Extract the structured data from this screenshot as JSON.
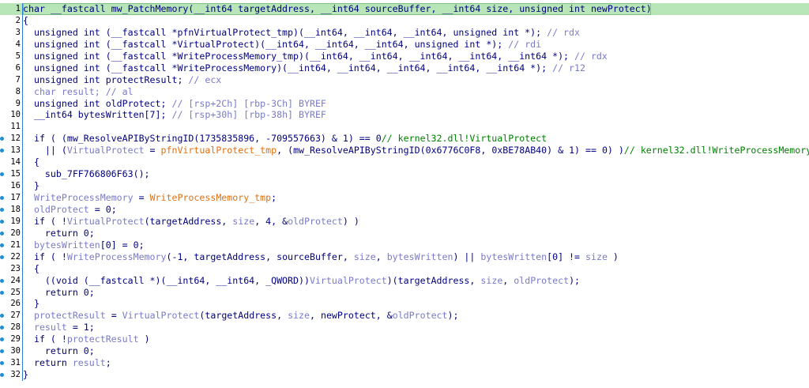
{
  "pseudocode": {
    "lines": [
      {
        "num": "1",
        "hl": true,
        "bp": false,
        "parts": [
          {
            "t": "char __fastcall mw_PatchMemory(__int64 targetAddress, __int64 sourceBuffer, __int64 size, unsigned int newProtect)",
            "c": "k"
          }
        ]
      },
      {
        "num": "2",
        "bp": false,
        "parts": [
          {
            "t": "{",
            "c": "k"
          }
        ]
      },
      {
        "num": "3",
        "bp": false,
        "parts": [
          {
            "t": "  unsigned int (__fastcall *pfnVirtualProtect_tmp)(__int64, __int64, __int64, unsigned int *); ",
            "c": "k"
          },
          {
            "t": "// rdx",
            "c": "c"
          }
        ]
      },
      {
        "num": "4",
        "bp": false,
        "parts": [
          {
            "t": "  unsigned int (__fastcall *VirtualProtect)(__int64, __int64, __int64, unsigned int *); ",
            "c": "k"
          },
          {
            "t": "// rdi",
            "c": "c"
          }
        ]
      },
      {
        "num": "5",
        "bp": false,
        "parts": [
          {
            "t": "  unsigned int (__fastcall *WriteProcessMemory_tmp)(__int64, __int64, __int64, __int64, __int64 *); ",
            "c": "k"
          },
          {
            "t": "// rdx",
            "c": "c"
          }
        ]
      },
      {
        "num": "6",
        "bp": false,
        "parts": [
          {
            "t": "  unsigned int (__fastcall *WriteProcessMemory)(__int64, __int64, __int64, __int64, __int64 *); ",
            "c": "k"
          },
          {
            "t": "// r12",
            "c": "c"
          }
        ]
      },
      {
        "num": "7",
        "bp": false,
        "parts": [
          {
            "t": "  unsigned int protectResult; ",
            "c": "k"
          },
          {
            "t": "// ecx",
            "c": "c"
          }
        ]
      },
      {
        "num": "8",
        "bp": false,
        "parts": [
          {
            "t": "  char result; ",
            "c": "c"
          },
          {
            "t": "// al",
            "c": "c"
          }
        ]
      },
      {
        "num": "9",
        "bp": false,
        "parts": [
          {
            "t": "  unsigned int oldProtect; ",
            "c": "k"
          },
          {
            "t": "// [rsp+2Ch] [rbp-3Ch] BYREF",
            "c": "c"
          }
        ]
      },
      {
        "num": "10",
        "bp": false,
        "parts": [
          {
            "t": "  __int64 bytesWritten[7]; ",
            "c": "k"
          },
          {
            "t": "// [rsp+30h] [rbp-38h] BYREF",
            "c": "c"
          }
        ]
      },
      {
        "num": "11",
        "bp": false,
        "parts": [
          {
            "t": "",
            "c": "k"
          }
        ]
      },
      {
        "num": "12",
        "bp": true,
        "parts": [
          {
            "t": "  if ( (mw_ResolveAPIByStringID(1735835896, -709557663) & 1) == 0",
            "c": "k"
          },
          {
            "t": "// kernel32.dll!VirtualProtect",
            "c": "g"
          }
        ]
      },
      {
        "num": "13",
        "bp": true,
        "parts": [
          {
            "t": "    || (",
            "c": "k"
          },
          {
            "t": "VirtualProtect",
            "c": "v"
          },
          {
            "t": " = ",
            "c": "k"
          },
          {
            "t": "pfnVirtualProtect_tmp",
            "c": "o"
          },
          {
            "t": ", (mw_ResolveAPIByStringID(0x6776C0F8, 0xBE78AB40) & 1) == 0) )",
            "c": "k"
          },
          {
            "t": "// kernel32.dll!WriteProcessMemory",
            "c": "g"
          }
        ]
      },
      {
        "num": "14",
        "bp": false,
        "parts": [
          {
            "t": "  {",
            "c": "k"
          }
        ]
      },
      {
        "num": "15",
        "bp": true,
        "parts": [
          {
            "t": "    sub_7FF766806F63();",
            "c": "k"
          }
        ]
      },
      {
        "num": "16",
        "bp": false,
        "parts": [
          {
            "t": "  }",
            "c": "k"
          }
        ]
      },
      {
        "num": "17",
        "bp": true,
        "parts": [
          {
            "t": "  ",
            "c": "k"
          },
          {
            "t": "WriteProcessMemory",
            "c": "v"
          },
          {
            "t": " = ",
            "c": "k"
          },
          {
            "t": "WriteProcessMemory_tmp",
            "c": "o"
          },
          {
            "t": ";",
            "c": "k"
          }
        ]
      },
      {
        "num": "18",
        "bp": true,
        "parts": [
          {
            "t": "  ",
            "c": "k"
          },
          {
            "t": "oldProtect",
            "c": "v"
          },
          {
            "t": " = 0;",
            "c": "k"
          }
        ]
      },
      {
        "num": "19",
        "bp": true,
        "parts": [
          {
            "t": "  if ( !",
            "c": "k"
          },
          {
            "t": "VirtualProtect",
            "c": "v"
          },
          {
            "t": "(targetAddress, ",
            "c": "k"
          },
          {
            "t": "size",
            "c": "v"
          },
          {
            "t": ", 4, &",
            "c": "k"
          },
          {
            "t": "oldProtect",
            "c": "v"
          },
          {
            "t": ") )",
            "c": "k"
          }
        ]
      },
      {
        "num": "20",
        "bp": true,
        "parts": [
          {
            "t": "    return 0;",
            "c": "k"
          }
        ]
      },
      {
        "num": "21",
        "bp": true,
        "parts": [
          {
            "t": "  ",
            "c": "k"
          },
          {
            "t": "bytesWritten",
            "c": "v"
          },
          {
            "t": "[0] = 0;",
            "c": "k"
          }
        ]
      },
      {
        "num": "22",
        "bp": true,
        "parts": [
          {
            "t": "  if ( !",
            "c": "k"
          },
          {
            "t": "WriteProcessMemory",
            "c": "v"
          },
          {
            "t": "(-1, targetAddress, sourceBuffer, ",
            "c": "k"
          },
          {
            "t": "size",
            "c": "v"
          },
          {
            "t": ", ",
            "c": "k"
          },
          {
            "t": "bytesWritten",
            "c": "v"
          },
          {
            "t": ") || ",
            "c": "k"
          },
          {
            "t": "bytesWritten",
            "c": "v"
          },
          {
            "t": "[0] != ",
            "c": "k"
          },
          {
            "t": "size",
            "c": "v"
          },
          {
            "t": " )",
            "c": "k"
          }
        ]
      },
      {
        "num": "23",
        "bp": false,
        "parts": [
          {
            "t": "  {",
            "c": "k"
          }
        ]
      },
      {
        "num": "24",
        "bp": true,
        "parts": [
          {
            "t": "    ((void (__fastcall *)(__int64, __int64, _QWORD))",
            "c": "k"
          },
          {
            "t": "VirtualProtect",
            "c": "v"
          },
          {
            "t": ")(targetAddress, ",
            "c": "k"
          },
          {
            "t": "size",
            "c": "v"
          },
          {
            "t": ", ",
            "c": "k"
          },
          {
            "t": "oldProtect",
            "c": "v"
          },
          {
            "t": ");",
            "c": "k"
          }
        ]
      },
      {
        "num": "25",
        "bp": true,
        "parts": [
          {
            "t": "    return 0;",
            "c": "k"
          }
        ]
      },
      {
        "num": "26",
        "bp": false,
        "parts": [
          {
            "t": "  }",
            "c": "k"
          }
        ]
      },
      {
        "num": "27",
        "bp": true,
        "parts": [
          {
            "t": "  ",
            "c": "k"
          },
          {
            "t": "protectResult",
            "c": "v"
          },
          {
            "t": " = ",
            "c": "k"
          },
          {
            "t": "VirtualProtect",
            "c": "v"
          },
          {
            "t": "(targetAddress, ",
            "c": "k"
          },
          {
            "t": "size",
            "c": "v"
          },
          {
            "t": ", newProtect, &",
            "c": "k"
          },
          {
            "t": "oldProtect",
            "c": "v"
          },
          {
            "t": ");",
            "c": "k"
          }
        ]
      },
      {
        "num": "28",
        "bp": true,
        "parts": [
          {
            "t": "  ",
            "c": "k"
          },
          {
            "t": "result",
            "c": "v"
          },
          {
            "t": " = 1;",
            "c": "k"
          }
        ]
      },
      {
        "num": "29",
        "bp": true,
        "parts": [
          {
            "t": "  if ( !",
            "c": "k"
          },
          {
            "t": "protectResult",
            "c": "v"
          },
          {
            "t": " )",
            "c": "k"
          }
        ]
      },
      {
        "num": "30",
        "bp": true,
        "parts": [
          {
            "t": "    return 0;",
            "c": "k"
          }
        ]
      },
      {
        "num": "31",
        "bp": true,
        "parts": [
          {
            "t": "  return ",
            "c": "k"
          },
          {
            "t": "result",
            "c": "v"
          },
          {
            "t": ";",
            "c": "k"
          }
        ]
      },
      {
        "num": "32",
        "bp": true,
        "parts": [
          {
            "t": "}",
            "c": "k"
          }
        ]
      }
    ]
  },
  "colors": {
    "keyword_text": "#000080",
    "comment_text": "#7a7ac8",
    "variable_text": "#7a7ac8",
    "assigned_function_text": "#e07010",
    "api_comment_text": "#008000",
    "highlight_line_bg": "#b9e6b9",
    "breakpoint_dot": "#1f8fd3"
  }
}
